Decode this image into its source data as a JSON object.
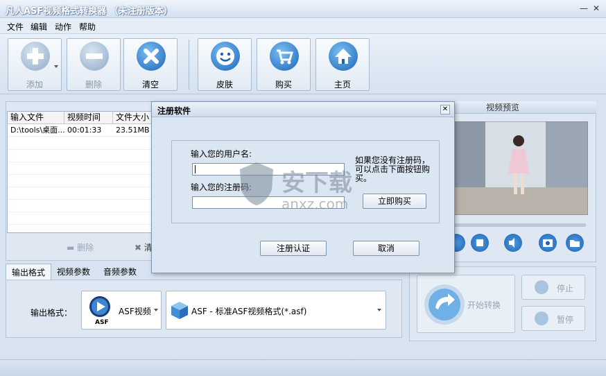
{
  "window": {
    "title": "凡人ASF视频格式转换器 （未注册版本）"
  },
  "menu": {
    "items": [
      "文件",
      "编辑",
      "动作",
      "帮助"
    ]
  },
  "toolbar": {
    "add": "添加",
    "delete": "删除",
    "clear": "清空",
    "skin": "皮肤",
    "buy": "购买",
    "home": "主页"
  },
  "file_table": {
    "headers": [
      "输入文件",
      "视频时间",
      "文件大小"
    ],
    "rows": [
      {
        "file": "D:\\tools\\桌面...",
        "time": "00:01:33",
        "size": "23.51MB"
      }
    ]
  },
  "list_actions": {
    "delete": "删除",
    "clear_partial": "清"
  },
  "tabs": [
    "输出格式",
    "视频参数",
    "音频参数"
  ],
  "output": {
    "label": "输出格式：",
    "format_name": "ASF视频",
    "format_icon_text": "ASF",
    "format_detail": "ASF - 标准ASF视频格式(*.asf)"
  },
  "preview": {
    "header": "视频预览"
  },
  "convert": {
    "start": "开始转换",
    "stop": "停止",
    "pause": "暂停"
  },
  "dialog": {
    "title": "注册软件",
    "username_label": "输入您的用户名:",
    "code_label": "输入您的注册码:",
    "hint": "如果您没有注册码，可以点击下面按钮购买。",
    "buy_now": "立即购买",
    "register": "注册认证",
    "cancel": "取消"
  },
  "watermark": {
    "text": "安下载",
    "sub": "anxz.com"
  }
}
